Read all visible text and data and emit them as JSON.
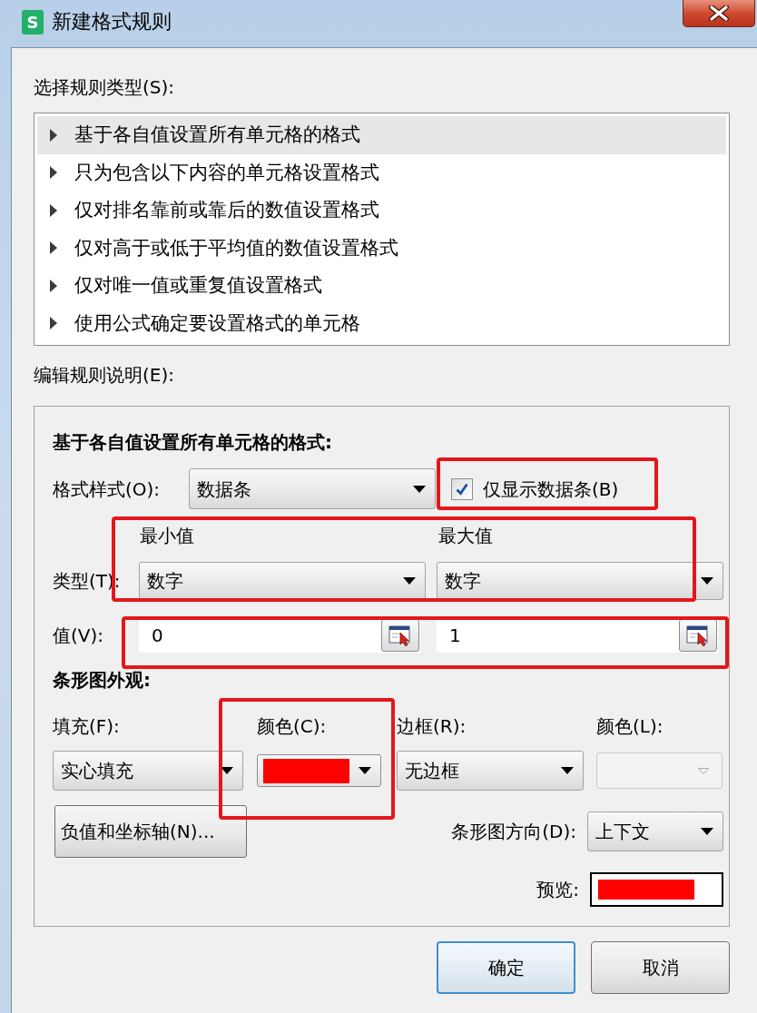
{
  "window": {
    "title": "新建格式规则",
    "logo_text": "S"
  },
  "rule_type": {
    "label": "选择规则类型(S):",
    "items": [
      {
        "label": "基于各自值设置所有单元格的格式",
        "selected": true
      },
      {
        "label": "只为包含以下内容的单元格设置格式",
        "selected": false
      },
      {
        "label": "仅对排名靠前或靠后的数值设置格式",
        "selected": false
      },
      {
        "label": "仅对高于或低于平均值的数值设置格式",
        "selected": false
      },
      {
        "label": "仅对唯一值或重复值设置格式",
        "selected": false
      },
      {
        "label": "使用公式确定要设置格式的单元格",
        "selected": false
      }
    ]
  },
  "rule_description": {
    "label": "编辑规则说明(E):",
    "heading": "基于各自值设置所有单元格的格式:",
    "format_style": {
      "label": "格式样式(O):",
      "value": "数据条"
    },
    "show_bar_only": {
      "label": "仅显示数据条(B)",
      "checked": true,
      "highlighted": true
    },
    "thresholds": {
      "columns": [
        {
          "heading": "最小值",
          "type": "数字",
          "value": "0"
        },
        {
          "heading": "最大值",
          "type": "数字",
          "value": "1"
        }
      ],
      "type_row": {
        "label": "类型(T):",
        "highlighted": true
      },
      "value_row": {
        "label": "值(V):",
        "highlighted": true
      }
    },
    "bar_appearance": {
      "heading": "条形图外观:",
      "fill": {
        "label": "填充(F):",
        "value": "实心填充"
      },
      "fill_color": {
        "label": "颜色(C):",
        "color": "#ff0000",
        "highlighted": true
      },
      "border": {
        "label": "边框(R):",
        "value": "无边框"
      },
      "border_color": {
        "label": "颜色(L):",
        "disabled": true
      },
      "axis_button": {
        "label": "负值和坐标轴(N)..."
      },
      "direction": {
        "label": "条形图方向(D):",
        "value": "上下文"
      },
      "preview": {
        "label": "预览:"
      }
    }
  },
  "buttons": [
    {
      "label": "确定",
      "default": true
    },
    {
      "label": "取消",
      "default": false
    }
  ]
}
